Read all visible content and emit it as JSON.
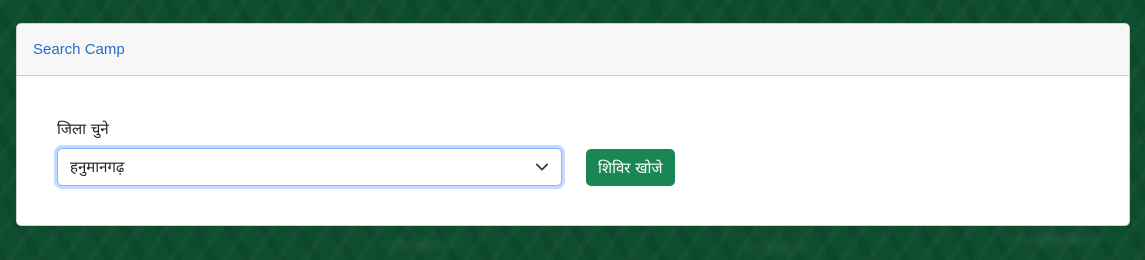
{
  "card": {
    "title": "Search Camp"
  },
  "form": {
    "district_label": "जिला चुने",
    "district_selected": "हनुमानगढ़",
    "submit_label": "शिविर खोजे"
  },
  "icons": {
    "select_arrow": "chevron-down-icon"
  },
  "colors": {
    "background": "#0f4d2f",
    "title_link": "#1f6fc8",
    "button": "#198754",
    "focus_border": "#86b7fe"
  }
}
